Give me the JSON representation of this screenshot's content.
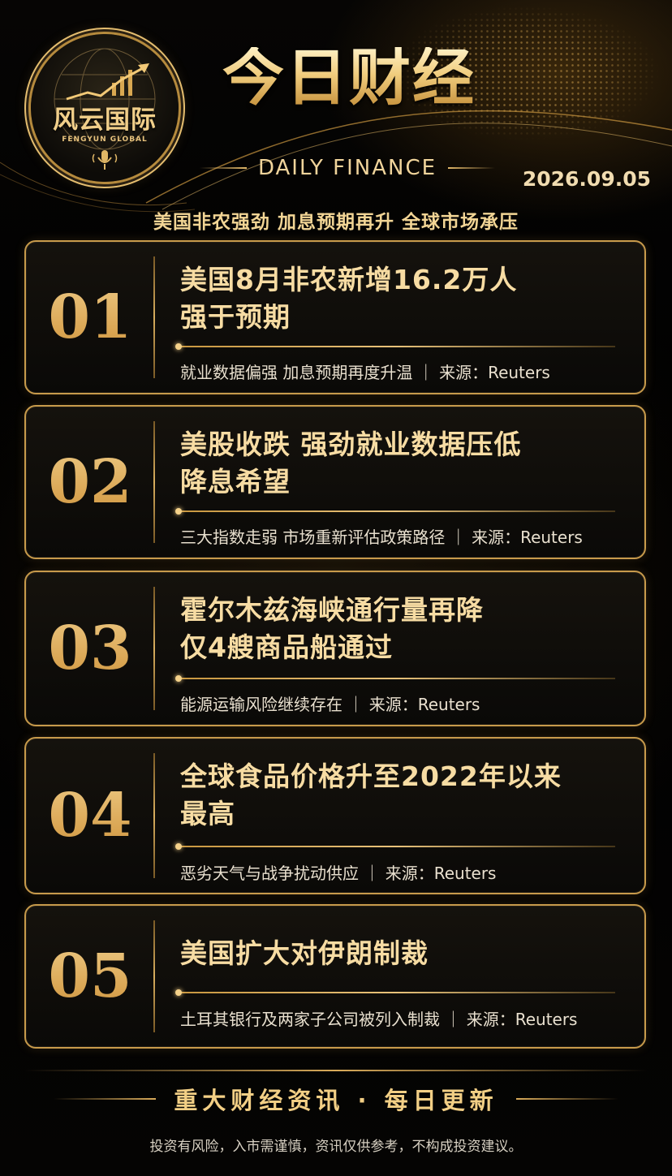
{
  "brand": {
    "name_cn": "风云国际",
    "name_en": "FENGYUN GLOBAL"
  },
  "header": {
    "title": "今日财经",
    "subtitle": "DAILY FINANCE",
    "date": "2026.09.05",
    "headline": "美国非农强劲 加息预期再升 全球市场承压"
  },
  "items": [
    {
      "num": "01",
      "title_line1": "美国8月非农新增16.2万人",
      "title_line2": "强于预期",
      "summary": "就业数据偏强 加息预期再度升温 ｜ 来源：Reuters"
    },
    {
      "num": "02",
      "title_line1": "美股收跌 强劲就业数据压低",
      "title_line2": "降息希望",
      "summary": "三大指数走弱 市场重新评估政策路径 ｜ 来源：Reuters"
    },
    {
      "num": "03",
      "title_line1": "霍尔木兹海峡通行量再降",
      "title_line2": "仅4艘商品船通过",
      "summary": "能源运输风险继续存在 ｜ 来源：Reuters"
    },
    {
      "num": "04",
      "title_line1": "全球食品价格升至2022年以来",
      "title_line2": "最高",
      "summary": "恶劣天气与战争扰动供应 ｜ 来源：Reuters"
    },
    {
      "num": "05",
      "title_line1": "美国扩大对伊朗制裁",
      "title_line2": "",
      "summary": "土耳其银行及两家子公司被列入制裁 ｜ 来源：Reuters"
    }
  ],
  "footer": {
    "slogan": "重大财经资讯 · 每日更新",
    "disclaimer": "投资有风险，入市需谨慎，资讯仅供参考，不构成投资建议。"
  },
  "colors": {
    "accent_gold": "#e2b869",
    "background": "#000000"
  },
  "icons": [
    "globe-icon",
    "trend-arrow-icon",
    "microphone-icon"
  ]
}
